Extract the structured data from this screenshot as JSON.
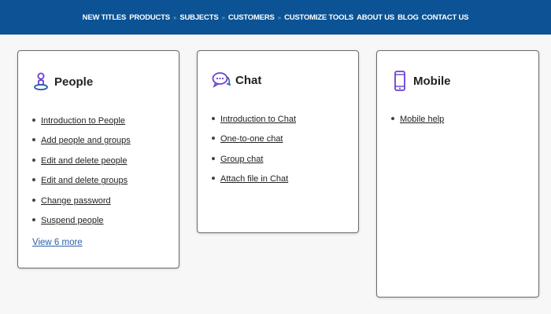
{
  "nav": {
    "items": [
      {
        "label": "NEW TITLES"
      },
      {
        "label": "PRODUCTS"
      },
      {
        "label": "SUBJECTS"
      },
      {
        "label": "CUSTOMERS"
      },
      {
        "label": "CUSTOMIZE TOOLS"
      },
      {
        "label": "ABOUT US"
      },
      {
        "label": "BLOG"
      },
      {
        "label": "CONTACT US"
      }
    ],
    "separator": "»",
    "background": "#0b5394"
  },
  "cards": {
    "people": {
      "title": "People",
      "icon": "person-icon",
      "links": [
        "Introduction to People",
        "Add people and groups",
        "Edit and delete people",
        "Edit and delete groups",
        "Change password",
        "Suspend people"
      ],
      "view_more": "View 6 more"
    },
    "chat": {
      "title": "Chat",
      "icon": "chat-bubbles-icon",
      "links": [
        "Introduction to Chat",
        "One-to-one chat",
        "Group chat",
        "Attach file in Chat"
      ]
    },
    "mobile": {
      "title": "Mobile",
      "icon": "mobile-phone-icon",
      "links": [
        "Mobile help"
      ]
    }
  },
  "colors": {
    "icon_accent": "#6a3fd4",
    "link_more": "#2b5ea8"
  }
}
